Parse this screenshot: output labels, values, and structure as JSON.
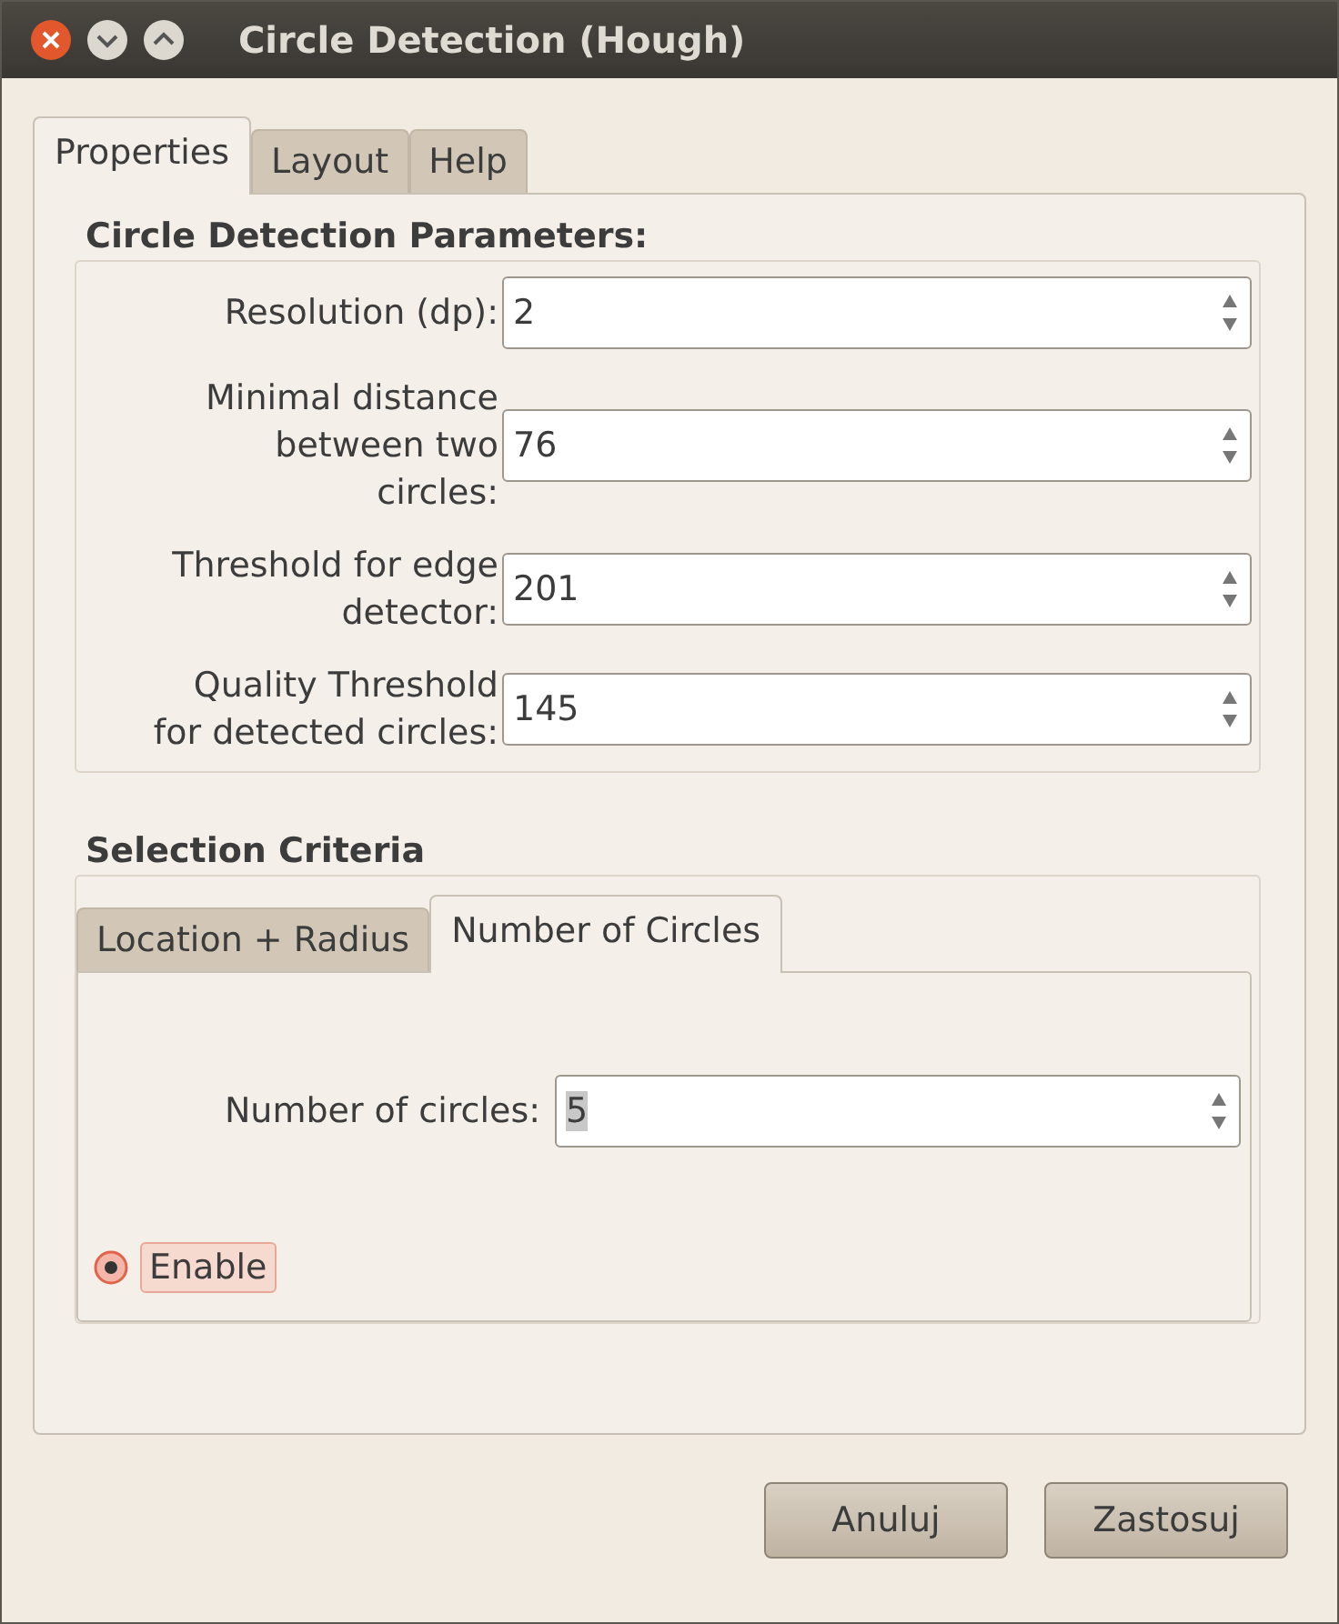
{
  "window": {
    "title": "Circle Detection (Hough)"
  },
  "tabs": [
    {
      "label": "Properties",
      "selected": true
    },
    {
      "label": "Layout",
      "selected": false
    },
    {
      "label": "Help",
      "selected": false
    }
  ],
  "parameters": {
    "title": "Circle Detection Parameters:",
    "fields": [
      {
        "label": "Resolution (dp):",
        "value": "2"
      },
      {
        "label": "Minimal distance\nbetween two\ncircles:",
        "value": "76"
      },
      {
        "label": "Threshold for edge\ndetector:",
        "value": "201"
      },
      {
        "label": "Quality Threshold\nfor detected circles:",
        "value": "145"
      }
    ]
  },
  "selection": {
    "title": "Selection Criteria",
    "tabs": [
      {
        "label": "Location + Radius",
        "selected": false
      },
      {
        "label": "Number of Circles",
        "selected": true
      }
    ],
    "number_field": {
      "label": "Number of circles:",
      "value": "5"
    },
    "enable": {
      "label": "Enable",
      "checked": true
    }
  },
  "buttons": [
    "Anuluj",
    "Zastosuj"
  ]
}
